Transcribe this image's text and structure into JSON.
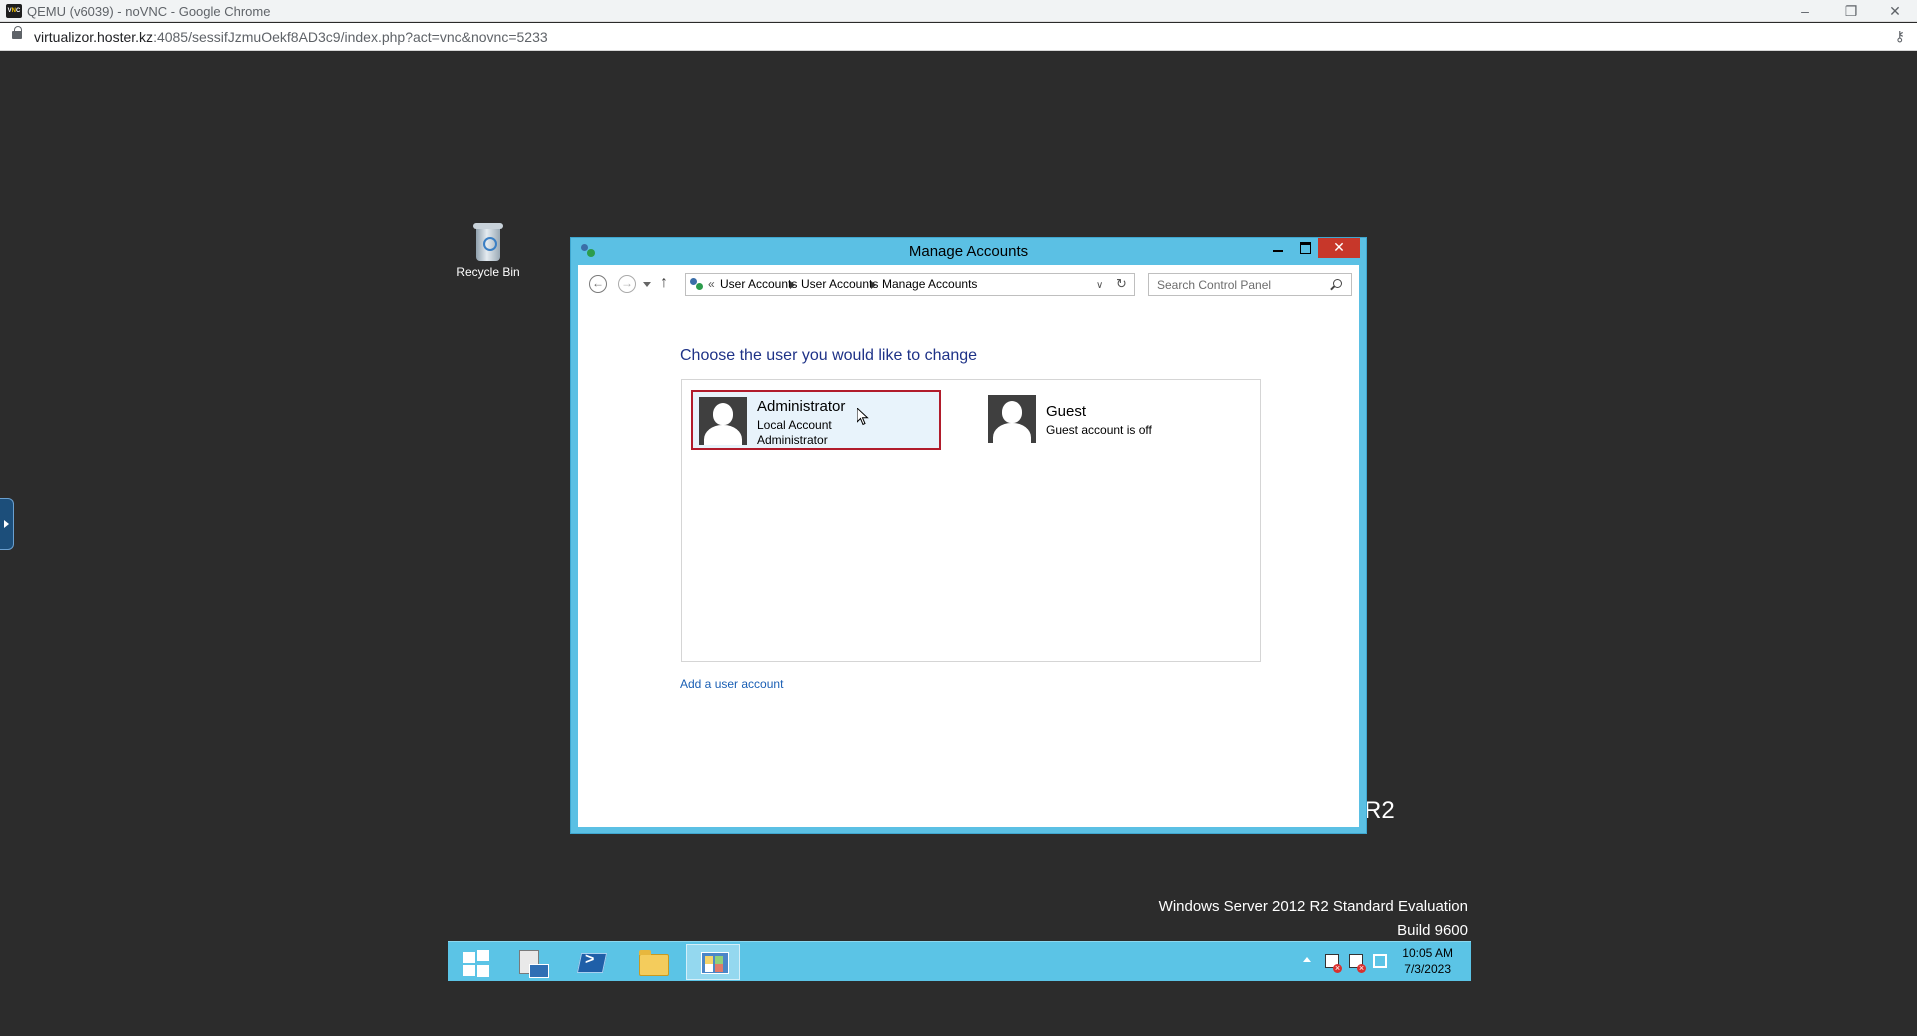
{
  "browser": {
    "title": "QEMU (v6039) - noVNC - Google Chrome",
    "url_host": "virtualizor.hoster.kz",
    "url_rest": ":4085/sessifJzmuOekf8AD3c9/index.php?act=vnc&novnc=5233",
    "min_glyph": "–",
    "restore_glyph": "❐",
    "close_glyph": "✕",
    "key_glyph": "⚷"
  },
  "desktop": {
    "recycle_bin_label": "Recycle Bin",
    "edition_line1": "Windows Server 2012 R2 Standard Evaluation",
    "edition_line2": "Build 9600",
    "partial_text": "R2"
  },
  "window": {
    "title": "Manage Accounts",
    "close_glyph": "✕",
    "nav": {
      "back_glyph": "←",
      "forward_glyph": "→",
      "up_glyph": "↑",
      "chevrons": "«",
      "breadcrumb": [
        "User Accounts",
        "User Accounts",
        "Manage Accounts"
      ],
      "dropdown_glyph": "∨",
      "refresh_glyph": "↻"
    },
    "search_placeholder": "Search Control Panel",
    "heading": "Choose the user you would like to change",
    "accounts": [
      {
        "name": "Administrator",
        "line1": "Local Account",
        "line2": "Administrator",
        "selected": true
      },
      {
        "name": "Guest",
        "line1": "Guest account is off",
        "selected": false
      }
    ],
    "add_user_link": "Add a user account"
  },
  "taskbar": {
    "items": [
      "start",
      "server-manager",
      "powershell",
      "file-explorer",
      "control-panel"
    ],
    "active_item": "control-panel",
    "clock_time": "10:05 AM",
    "clock_date": "7/3/2023"
  },
  "colors": {
    "window_frame": "#5bc0e4",
    "taskbar": "#5bc4e6",
    "selection_border": "#b11b2b",
    "heading": "#1e3287",
    "link": "#1a5fb4"
  }
}
